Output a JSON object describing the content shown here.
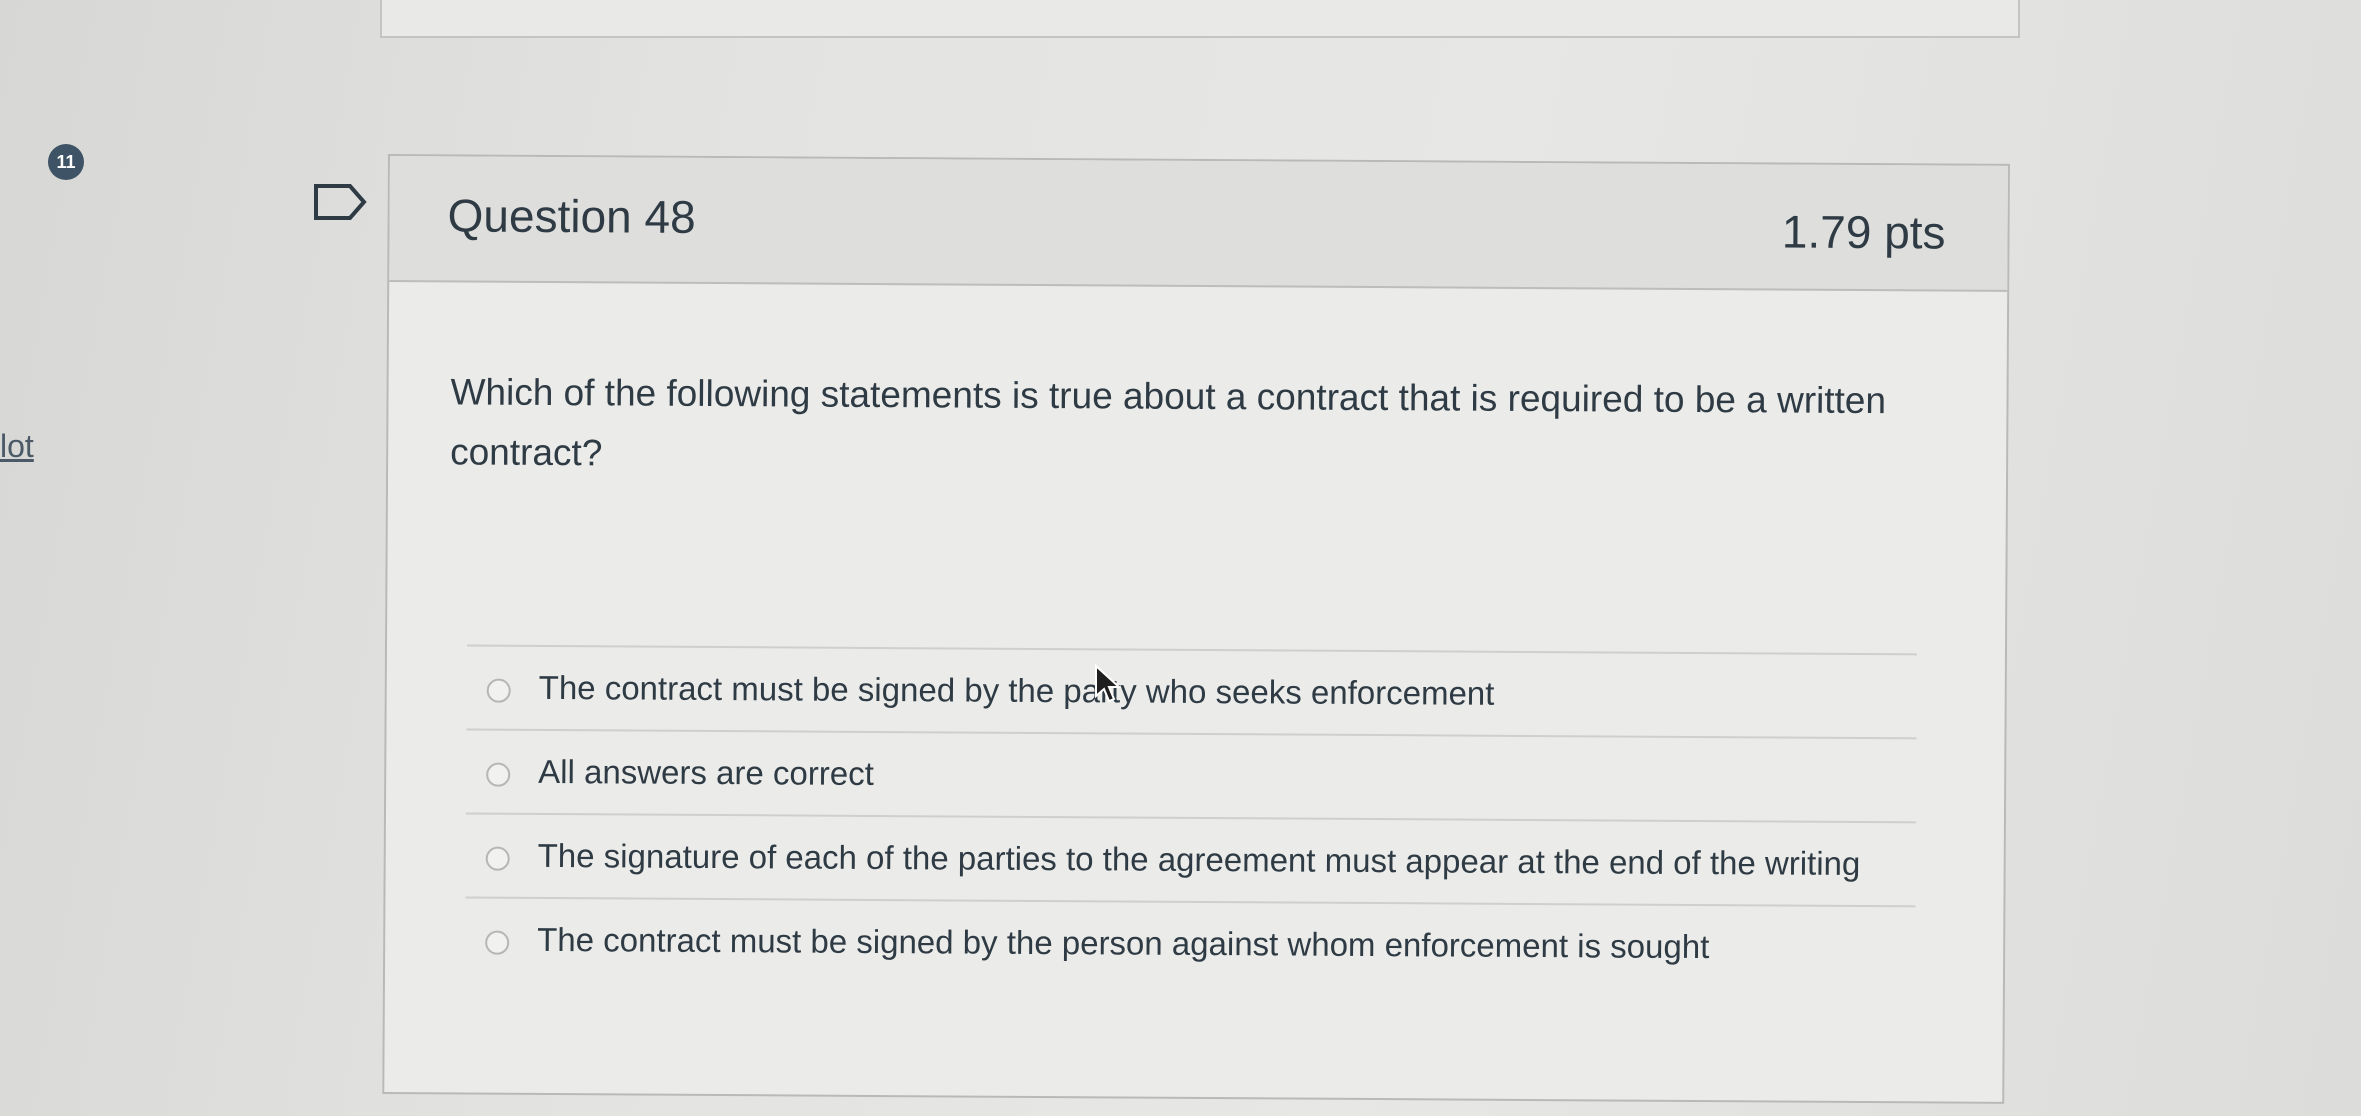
{
  "question": {
    "badge": "11",
    "side_link": "lot",
    "title": "Question 48",
    "points": "1.79 pts",
    "text": "Which of the following statements is true about a contract that is required to be a written contract?",
    "answers": [
      "The contract must be signed by the party who seeks enforcement",
      "All answers are correct",
      "The signature of each of the parties to the agreement must appear at the end of the writing",
      "The contract must be signed by the person against whom enforcement is sought"
    ]
  },
  "icons": {
    "flag": "bookmark-flag-icon",
    "cursor": "mouse-pointer-icon"
  }
}
